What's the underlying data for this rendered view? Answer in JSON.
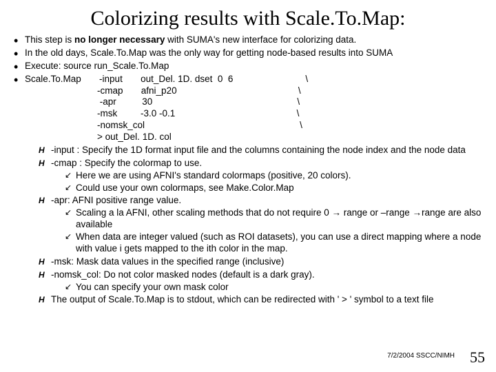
{
  "title": "Colorizing results with Scale.To.Map:",
  "bul": {
    "b0_pre": "This step is ",
    "b0_bold": "no longer necessary",
    "b0_post": " with SUMA's new interface for colorizing data.",
    "b1": "In the old days, Scale.To.Map was the only way for getting node-based results into SUMA",
    "b2": "Execute: source run_Scale.To.Map",
    "b3": "Scale.To.Map       -input       out_Del. 1D. dset  0  6                            \\\n                            -cmap       afni_p20                                               \\\n                             -apr          30                                                        \\\n                            -msk         -3.0 -0.1                                               \\\n                            -nomsk_col                                                            \\\n                            > out_Del. 1D. col"
  },
  "sub": {
    "s0": "-input : Specify the 1D format input file and the columns containing the node index and the node data",
    "s1": "-cmap : Specify the colormap to use.",
    "s1a": "Here we are using AFNI's standard colormaps (positive, 20 colors).",
    "s1b": "Could use your own colormaps, see Make.Color.Map",
    "s2": "-apr: AFNI positive range value.",
    "s2a_pre": "Scaling a la AFNI, other scaling methods that do not require 0 ",
    "s2a_mid": " range or –range ",
    "s2a_post": "range are also available",
    "s2b": "When data are integer valued (such as ROI datasets), you can use a direct mapping where a node with value i gets mapped to the ith color in the map.",
    "s3": "-msk: Mask data values in the specified range (inclusive)",
    "s4": "-nomsk_col: Do not color masked nodes (default is a dark gray).",
    "s4a": "You can specify your own mask color",
    "s5": "The output of Scale.To.Map is to stdout, which can be redirected with ' > ' symbol to a text file"
  },
  "footer": {
    "date": "7/2/2004 SSCC/NIMH",
    "page": "55"
  }
}
